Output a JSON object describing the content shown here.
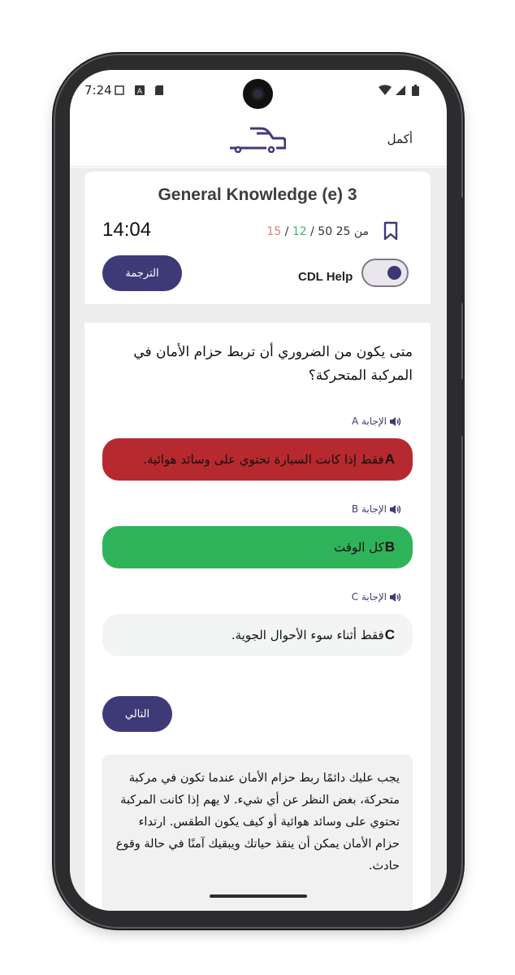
{
  "status_bar": {
    "time": "7:24"
  },
  "app_bar": {
    "done_label": "أكمل",
    "logo": "truck-icon"
  },
  "quiz": {
    "title": "General Knowledge (e) 3",
    "timer": "14:04",
    "progress_current": "25",
    "progress_of": "من",
    "progress_total": "50",
    "progress_correct": "12",
    "progress_wrong": "15",
    "progress_sep": "/",
    "cdl_help_label": "CDL Help",
    "cdl_help_on": true,
    "translate_label": "الترجمة"
  },
  "question": {
    "text": "متى يكون من الضروري أن تربط حزام الأمان في المركبة المتحركة؟",
    "answers": [
      {
        "label": "الإجابة A",
        "letter": "A",
        "text": "فقط إذا كانت السيارة تحتوي على وسائد هوائية.",
        "state": "incorrect"
      },
      {
        "label": "الإجابة B",
        "letter": "B",
        "text": "كل الوقت",
        "state": "correct"
      },
      {
        "label": "الإجابة C",
        "letter": "C",
        "text": "فقط أثناء سوء الأحوال الجوية.",
        "state": "neutral"
      }
    ],
    "next_label": "التالي",
    "explanation": "يجب عليك دائمًا ربط حزام الأمان عندما تكون في مركبة متحركة، بغض النظر عن أي شيء. لا يهم إذا كانت المركبة تحتوي على وسائد هوائية أو كيف يكون الطقس. ارتداء حزام الأمان يمكن أن ينقذ حياتك ويبقيك آمنًا في حالة وقوع حادث."
  },
  "colors": {
    "primary": "#3e3a78",
    "incorrect": "#b62a2f",
    "correct": "#2fb35a",
    "correct_count": "#3cb46a",
    "wrong_count": "#e07b7b"
  }
}
